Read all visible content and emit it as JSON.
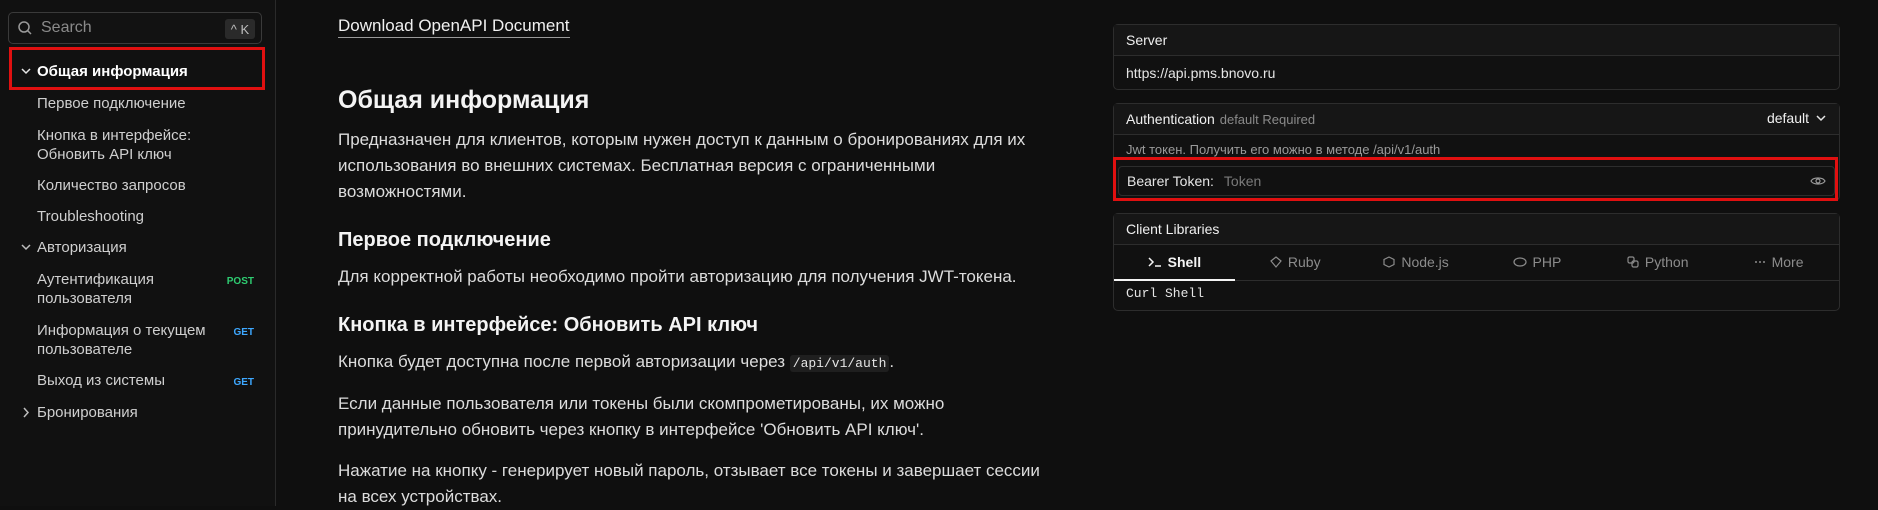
{
  "sidebar": {
    "search_placeholder": "Search",
    "shortcut": "^ K",
    "items": [
      {
        "label": "Общая информация"
      },
      {
        "label": "Первое подключение"
      },
      {
        "label": "Кнопка в интерфейсе:"
      },
      {
        "label": "Обновить API ключ"
      },
      {
        "label": "Количество запросов"
      },
      {
        "label": "Troubleshooting"
      },
      {
        "label": "Авторизация"
      },
      {
        "label": "Аутентификация",
        "badge": "POST"
      },
      {
        "label": "пользователя"
      },
      {
        "label": "Информация о текущем",
        "badge": "GET"
      },
      {
        "label": "пользователе"
      },
      {
        "label": "Выход из системы",
        "badge": "GET"
      },
      {
        "label": "Бронирования"
      }
    ]
  },
  "main": {
    "download_link": "Download OpenAPI Document",
    "title": "Общая информация",
    "intro_1": "Предназначен для клиентов, которым нужен доступ к данным о бронированиях для их",
    "intro_2": "использования во внешних системах. Бесплатная версия с ограниченными",
    "intro_3": "возможностями.",
    "section1_title": "Первое подключение",
    "section1_text": "Для корректной работы необходимо пройти авторизацию для получения JWT-токена.",
    "section2_title": "Кнопка в интерфейсе: Обновить API ключ",
    "section2_text_before": "Кнопка будет доступна после первой авторизации через",
    "section2_code": "/api/v1/auth",
    "section2_text_after": ".",
    "para2_1": "Если данные пользователя или токены были скомпрометированы, их можно",
    "para2_2": "принудительно обновить через кнопку в интерфейсе 'Обновить API ключ'.",
    "para3_1": "Нажатие на кнопку - генерирует новый пароль, отзывает все токены и завершает сессии",
    "para3_2": "на всех устройствах."
  },
  "server": {
    "label": "Server",
    "url": "https://api.pms.bnovo.ru"
  },
  "auth": {
    "label": "Authentication",
    "meta": "default Required",
    "selected": "default",
    "description": "Jwt токен. Получить его можно в методе /api/v1/auth",
    "token_label": "Bearer Token:",
    "token_placeholder": "Token"
  },
  "client": {
    "label": "Client Libraries",
    "tabs": [
      "Shell",
      "Ruby",
      "Node.js",
      "PHP",
      "Python",
      "More"
    ],
    "active_tab": "Shell",
    "content": "Curl Shell"
  },
  "colors": {
    "highlight": "#e01010",
    "post": "#2ecc71",
    "get": "#3ea8ff"
  }
}
